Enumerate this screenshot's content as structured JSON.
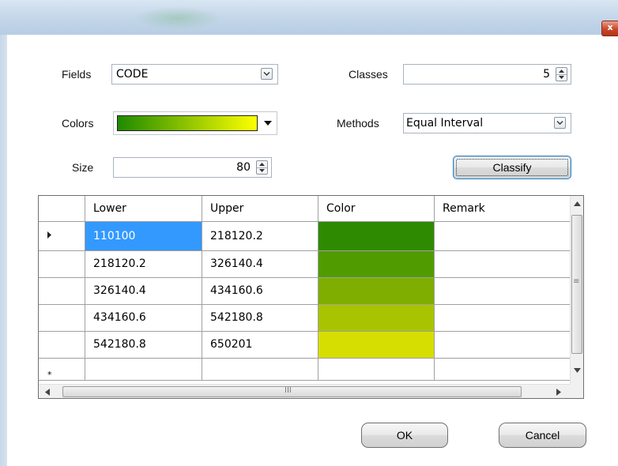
{
  "window": {
    "close_glyph": "x"
  },
  "form": {
    "fields_label": "Fields",
    "fields_value": "CODE",
    "classes_label": "Classes",
    "classes_value": "5",
    "colors_label": "Colors",
    "color_ramp": {
      "from": "#1f8a00",
      "to": "#ffff00"
    },
    "methods_label": "Methods",
    "methods_value": "Equal Interval",
    "size_label": "Size",
    "size_value": "80",
    "classify_label": "Classify"
  },
  "grid": {
    "columns": [
      "Lower",
      "Upper",
      "Color",
      "Remark"
    ],
    "rows": [
      {
        "lower": "110100",
        "upper": "218120.2",
        "color": "#2e8a00",
        "remark": ""
      },
      {
        "lower": "218120.2",
        "upper": "326140.4",
        "color": "#509c00",
        "remark": ""
      },
      {
        "lower": "326140.4",
        "upper": "434160.6",
        "color": "#7fad00",
        "remark": ""
      },
      {
        "lower": "434160.6",
        "upper": "542180.8",
        "color": "#a8c400",
        "remark": ""
      },
      {
        "lower": "542180.8",
        "upper": "650201",
        "color": "#d6dd00",
        "remark": ""
      }
    ],
    "selected_row": 0,
    "new_row_marker": "*",
    "current_row_marker": "▶",
    "hscroll_mark": "III",
    "vscroll_mark": "≡"
  },
  "buttons": {
    "ok": "OK",
    "cancel": "Cancel"
  }
}
